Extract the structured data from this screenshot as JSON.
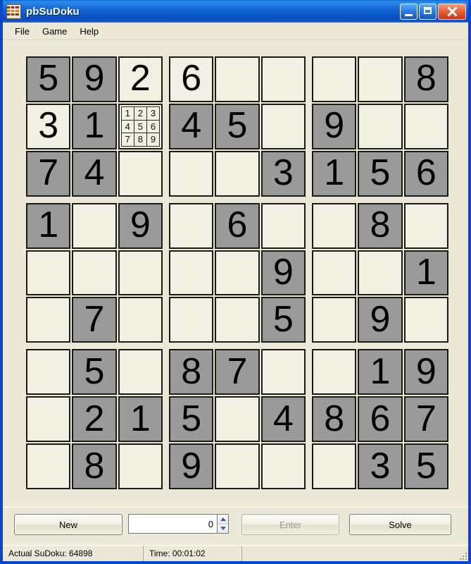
{
  "window": {
    "title": "pbSuDoku",
    "icon": "sudoku-app-icon",
    "minimize_label": "Minimize",
    "maximize_label": "Maximize",
    "close_label": "Close"
  },
  "menu": {
    "items": [
      {
        "label": "File"
      },
      {
        "label": "Game"
      },
      {
        "label": "Help"
      }
    ]
  },
  "colors": {
    "given_cell": "#9a9a9a",
    "empty_cell": "#f2f0e2",
    "cell_border": "#1b1b16",
    "window_face": "#ece9d8",
    "title_blue": "#0a46c8",
    "close_red": "#cc3311",
    "spinner_arrow": "#3a5fa8",
    "disabled_text": "#9a9a8e"
  },
  "board": {
    "size": 9,
    "blocks": 3,
    "legend": {
      "given": "grey background = given clue",
      "user": "light background = user entry or empty",
      "candidates": "cell shows 3x3 candidate pad 1-9"
    },
    "cells": [
      [
        {
          "value": "5",
          "given": true
        },
        {
          "value": "9",
          "given": true
        },
        {
          "value": "2",
          "given": false
        },
        {
          "value": "6",
          "given": false
        },
        {
          "value": "",
          "given": false
        },
        {
          "value": "",
          "given": false
        },
        {
          "value": "",
          "given": false
        },
        {
          "value": "",
          "given": false
        },
        {
          "value": "8",
          "given": true
        }
      ],
      [
        {
          "value": "3",
          "given": false
        },
        {
          "value": "1",
          "given": true
        },
        {
          "value": "",
          "given": false,
          "candidates": [
            "1",
            "2",
            "3",
            "4",
            "5",
            "6",
            "7",
            "8",
            "9"
          ]
        },
        {
          "value": "4",
          "given": true
        },
        {
          "value": "5",
          "given": true
        },
        {
          "value": "",
          "given": false
        },
        {
          "value": "9",
          "given": true
        },
        {
          "value": "",
          "given": false
        },
        {
          "value": "",
          "given": false
        }
      ],
      [
        {
          "value": "7",
          "given": true
        },
        {
          "value": "4",
          "given": true
        },
        {
          "value": "",
          "given": false
        },
        {
          "value": "",
          "given": false
        },
        {
          "value": "",
          "given": false
        },
        {
          "value": "3",
          "given": true
        },
        {
          "value": "1",
          "given": true
        },
        {
          "value": "5",
          "given": true
        },
        {
          "value": "6",
          "given": true
        }
      ],
      [
        {
          "value": "1",
          "given": true
        },
        {
          "value": "",
          "given": false
        },
        {
          "value": "9",
          "given": true
        },
        {
          "value": "",
          "given": false
        },
        {
          "value": "6",
          "given": true
        },
        {
          "value": "",
          "given": false
        },
        {
          "value": "",
          "given": false
        },
        {
          "value": "8",
          "given": true
        },
        {
          "value": "",
          "given": false
        }
      ],
      [
        {
          "value": "",
          "given": false
        },
        {
          "value": "",
          "given": false
        },
        {
          "value": "",
          "given": false
        },
        {
          "value": "",
          "given": false
        },
        {
          "value": "",
          "given": false
        },
        {
          "value": "9",
          "given": true
        },
        {
          "value": "",
          "given": false
        },
        {
          "value": "",
          "given": false
        },
        {
          "value": "1",
          "given": true
        }
      ],
      [
        {
          "value": "",
          "given": false
        },
        {
          "value": "7",
          "given": true
        },
        {
          "value": "",
          "given": false
        },
        {
          "value": "",
          "given": false
        },
        {
          "value": "",
          "given": false
        },
        {
          "value": "5",
          "given": true
        },
        {
          "value": "",
          "given": false
        },
        {
          "value": "9",
          "given": true
        },
        {
          "value": "",
          "given": false
        }
      ],
      [
        {
          "value": "",
          "given": false
        },
        {
          "value": "5",
          "given": true
        },
        {
          "value": "",
          "given": false
        },
        {
          "value": "8",
          "given": true
        },
        {
          "value": "7",
          "given": true
        },
        {
          "value": "",
          "given": false
        },
        {
          "value": "",
          "given": false
        },
        {
          "value": "1",
          "given": true
        },
        {
          "value": "9",
          "given": true
        }
      ],
      [
        {
          "value": "",
          "given": false
        },
        {
          "value": "2",
          "given": true
        },
        {
          "value": "1",
          "given": true
        },
        {
          "value": "5",
          "given": true
        },
        {
          "value": "",
          "given": false
        },
        {
          "value": "4",
          "given": true
        },
        {
          "value": "8",
          "given": true
        },
        {
          "value": "6",
          "given": true
        },
        {
          "value": "7",
          "given": true
        }
      ],
      [
        {
          "value": "",
          "given": false
        },
        {
          "value": "8",
          "given": true
        },
        {
          "value": "",
          "given": false
        },
        {
          "value": "9",
          "given": true
        },
        {
          "value": "",
          "given": false
        },
        {
          "value": "",
          "given": false
        },
        {
          "value": "",
          "given": false
        },
        {
          "value": "3",
          "given": true
        },
        {
          "value": "5",
          "given": true
        }
      ]
    ]
  },
  "controls": {
    "new_label": "New",
    "enter_label": "Enter",
    "enter_disabled": true,
    "solve_label": "Solve",
    "spinner": {
      "value": "0",
      "up_label": "Increment",
      "down_label": "Decrement"
    }
  },
  "statusbar": {
    "sudoku_id": "Actual SuDoku: 64898",
    "time": "Time: 00:01:02",
    "extra": ""
  }
}
